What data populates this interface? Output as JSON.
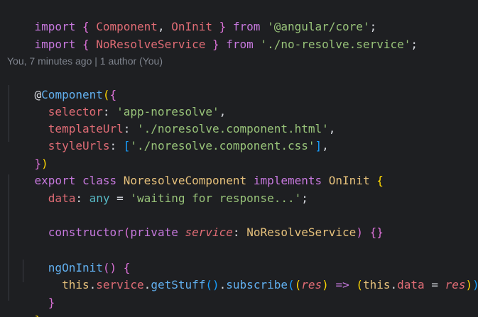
{
  "editor": {
    "lines": {
      "l1": {
        "kw_import": "import",
        "open": " { ",
        "t1": "Component",
        "comma": ", ",
        "t2": "OnInit",
        "close": " } ",
        "kw_from": "from",
        "sp": " ",
        "str": "'@angular/core'",
        "semi": ";"
      },
      "l2": {
        "kw_import": "import",
        "open": " { ",
        "t1": "NoResolveService",
        "close": " } ",
        "kw_from": "from",
        "sp": " ",
        "str": "'./no-resolve.service'",
        "semi": ";"
      },
      "blame": "You, 7 minutes ago | 1 author (You)",
      "l3": {
        "at": "@",
        "name": "Component",
        "paren": "(",
        "brace": "{"
      },
      "l4": {
        "indent": "  ",
        "key": "selector",
        "colon": ": ",
        "value": "'app-noresolve'",
        "comma": ","
      },
      "l5": {
        "indent": "  ",
        "key": "templateUrl",
        "colon": ": ",
        "value": "'./noresolve.component.html'",
        "comma": ","
      },
      "l6": {
        "indent": "  ",
        "key": "styleUrls",
        "colon": ": ",
        "bracket_open": "[",
        "value": "'./noresolve.component.css'",
        "bracket_close": "]",
        "comma": ","
      },
      "l7": {
        "brace": "}",
        "paren": ")"
      },
      "l8": {
        "kw_export": "export",
        "sp1": " ",
        "kw_class": "class",
        "sp2": " ",
        "name": "NoresolveComponent",
        "sp3": " ",
        "kw_implements": "implements",
        "sp4": " ",
        "iface": "OnInit",
        "sp5": " ",
        "brace": "{"
      },
      "l9": {
        "indent": "  ",
        "prop": "data",
        "colon": ": ",
        "type": "any",
        "eq": " = ",
        "value": "'waiting for response...'",
        "semi": ";"
      },
      "l10": {
        "indent": "  ",
        "fn": "constructor",
        "paren_open": "(",
        "kw_private": "private",
        "sp": " ",
        "param": "service",
        "colon": ": ",
        "type": "NoResolveService",
        "paren_close": ")",
        "sp2": " ",
        "braces": "{}"
      },
      "l11": {
        "indent": "  ",
        "fn": "ngOnInit",
        "parens": "()",
        "sp": " ",
        "brace": "{"
      },
      "l12": {
        "indent": "    ",
        "this1": "this",
        "dot1": ".",
        "prop1": "service",
        "dot2": ".",
        "fn1": "getStuff",
        "call1": "()",
        "dot3": ".",
        "fn2": "subscribe",
        "p1": "(",
        "p2": "(",
        "param": "res",
        "p3": ")",
        "arrow": " => ",
        "p4": "(",
        "this2": "this",
        "dot4": ".",
        "prop2": "data",
        "eq": " = ",
        "param2": "res",
        "p5": ")",
        "p6": ")",
        "semi": ";"
      },
      "l13": {
        "indent": "  ",
        "brace": "}"
      },
      "l14": {
        "brace": "}"
      }
    }
  },
  "colors": {
    "background": "#1e1f22",
    "keyword": "#c678dd",
    "type": "#e5c07b",
    "string": "#98c379",
    "property": "#e06c75",
    "function": "#61afef",
    "bracket_level1": "#ffd700",
    "bracket_level2": "#da70d6",
    "bracket_level3": "#179fff",
    "blame_text": "#7f848e"
  }
}
